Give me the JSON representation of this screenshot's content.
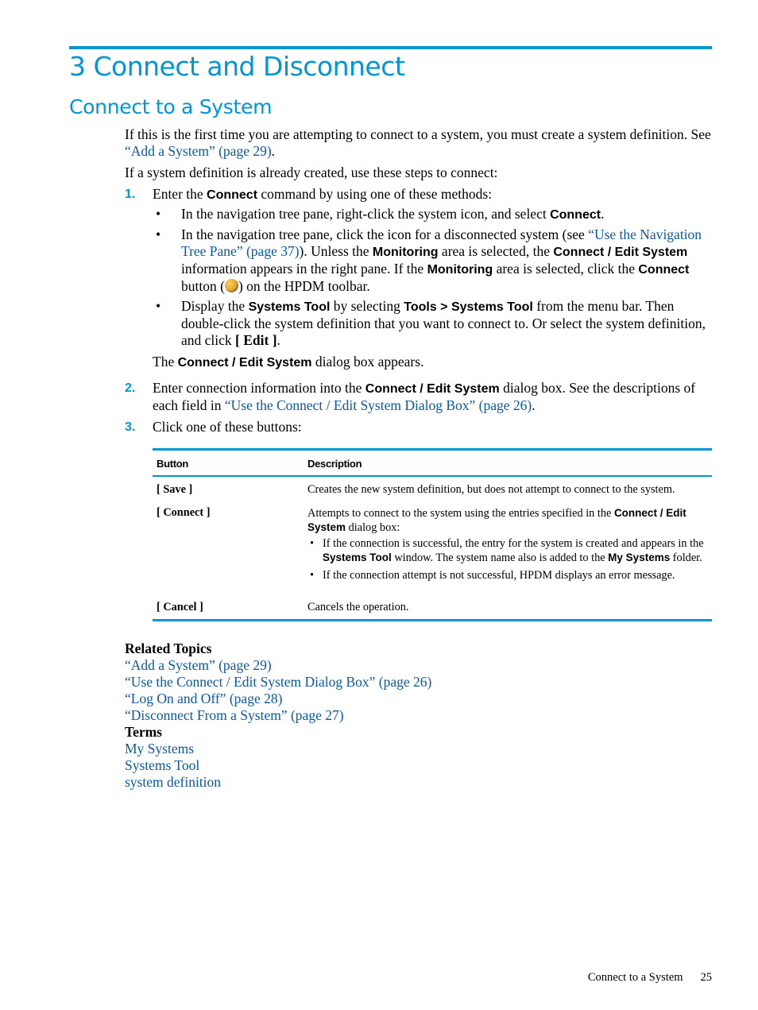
{
  "colors": {
    "accent": "#0096d6",
    "link": "#0a5aa5"
  },
  "chapter": {
    "title": "3 Connect and Disconnect"
  },
  "section": {
    "title": "Connect to a System"
  },
  "intro": {
    "p1_text": "If this is the first time you are attempting to connect to a system, you must create a system definition. See ",
    "p1_link": "“Add a System” (page 29)",
    "p1_end": ".",
    "p2": "If a system definition is already created, use these steps to connect:"
  },
  "steps": [
    {
      "num": "1.",
      "pre": "Enter the ",
      "bold": "Connect",
      "post": " command by using one of these methods:",
      "bullets": {
        "b1": {
          "pre": "In the navigation tree pane, right-click the system icon, and select ",
          "bold": "Connect",
          "post": "."
        },
        "b2": {
          "pre": "In the navigation tree pane, click the icon for a disconnected system (see ",
          "link": "“Use the Navigation Tree Pane” (page 37)",
          "mid1": "). Unless the ",
          "bold1": "Monitoring",
          "mid2": " area is selected, the ",
          "bold2": "Connect / Edit System",
          "mid3": " information appears in the right pane. If the ",
          "bold3": "Monitoring",
          "mid4": " area is selected, click the ",
          "bold4": "Connect",
          "mid5": " button (",
          "icon": "connect-toolbar-icon",
          "post": ") on the HPDM toolbar."
        },
        "b3": {
          "pre": "Display the ",
          "bold1": "Systems Tool",
          "mid1": " by selecting ",
          "bold2": "Tools > Systems Tool",
          "mid2": " from the menu bar. Then double-click the system definition that you want to connect to. Or select the system definition, and click ",
          "bold3": "[ Edit ]",
          "post": "."
        }
      },
      "after": {
        "pre": "The ",
        "bold": "Connect / Edit System",
        "post": " dialog box appears."
      }
    },
    {
      "num": "2.",
      "pre": "Enter connection information into the ",
      "bold": "Connect / Edit System",
      "mid": " dialog box. See the descriptions of each field in ",
      "link": "“Use the Connect / Edit System Dialog Box” (page 26)",
      "post": "."
    },
    {
      "num": "3.",
      "text": "Click one of these buttons:"
    }
  ],
  "table": {
    "headers": [
      "Button",
      "Description"
    ],
    "rows": {
      "save": {
        "button": "[ Save ]",
        "desc": "Creates the new system definition, but does not attempt to connect to the system."
      },
      "connect": {
        "button": "[ Connect ]",
        "desc_pre": "Attempts to connect to the system using the entries specified in the ",
        "desc_bold": "Connect / Edit System",
        "desc_post": " dialog box:",
        "b1_pre": "If the connection is successful, the entry for the system is created and appears in the ",
        "b1_bold1": "Systems Tool",
        "b1_mid": " window. The system name also is added to the ",
        "b1_bold2": "My Systems",
        "b1_post": " folder.",
        "b2": "If the connection attempt is not successful, HPDM displays an error message."
      },
      "cancel": {
        "button": "[ Cancel ]",
        "desc": "Cancels the operation."
      }
    }
  },
  "related": {
    "heading": "Related Topics",
    "links": [
      "“Add a System” (page 29)",
      "“Use the Connect / Edit System Dialog Box” (page 26)",
      "“Log On and Off” (page 28)",
      "“Disconnect From a System” (page 27)"
    ],
    "terms_heading": "Terms",
    "terms": [
      "My Systems",
      "Systems Tool",
      "system definition"
    ]
  },
  "footer": {
    "section": "Connect to a System",
    "page": "25"
  },
  "bullet_char": "•"
}
